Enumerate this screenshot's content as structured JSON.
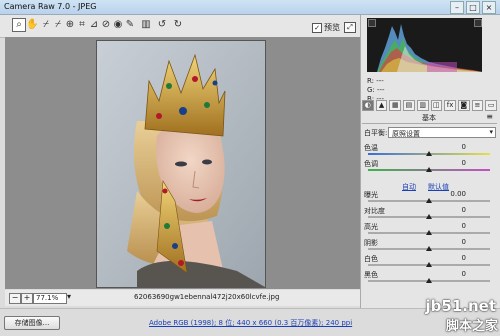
{
  "window": {
    "title": "Camera Raw 7.0 - JPEG"
  },
  "toolbar": {
    "tools": [
      "zoom-icon",
      "hand-icon",
      "eyedropper-icon",
      "color-sampler-icon",
      "target-adjust-icon",
      "crop-icon",
      "straighten-icon",
      "spot-removal-icon",
      "red-eye-icon",
      "adjustment-brush-icon",
      "graduated-filter-icon",
      "rotate-left-icon",
      "rotate-right-icon"
    ],
    "preview_label": "预览",
    "preview_checked": true
  },
  "status": {
    "zoom": "77.1%",
    "filename": "62063690gw1ebennal472j20x60lcvfe.jpg"
  },
  "bottom": {
    "save_label": "存储图像...",
    "workflow": "Adobe RGB (1998); 8 位; 440 x 660 (0.3 百万像素); 240 ppi"
  },
  "readout": {
    "r": "R:  ---",
    "g": "G:  ---",
    "b": "B:  ---"
  },
  "panel": {
    "heading": "基本",
    "white_balance_label": "白平衡:",
    "white_balance_value": "原照设置",
    "auto_label": "自动",
    "default_label": "默认值",
    "controls": [
      {
        "label": "色温",
        "value": "0",
        "level": 0.5,
        "track": "temp"
      },
      {
        "label": "色调",
        "value": "0",
        "level": 0.5,
        "track": "tint"
      },
      {
        "label": "曝光",
        "value": "0.00",
        "level": 0.5,
        "track": "gray"
      },
      {
        "label": "对比度",
        "value": "0",
        "level": 0.5,
        "track": "gray"
      },
      {
        "label": "高光",
        "value": "0",
        "level": 0.5,
        "track": "gray"
      },
      {
        "label": "阴影",
        "value": "0",
        "level": 0.5,
        "track": "gray"
      },
      {
        "label": "白色",
        "value": "0",
        "level": 0.5,
        "track": "gray"
      },
      {
        "label": "黑色",
        "value": "0",
        "level": 0.5,
        "track": "gray"
      }
    ]
  },
  "watermark": {
    "site": "jb51.net",
    "name": "脚本之家"
  }
}
